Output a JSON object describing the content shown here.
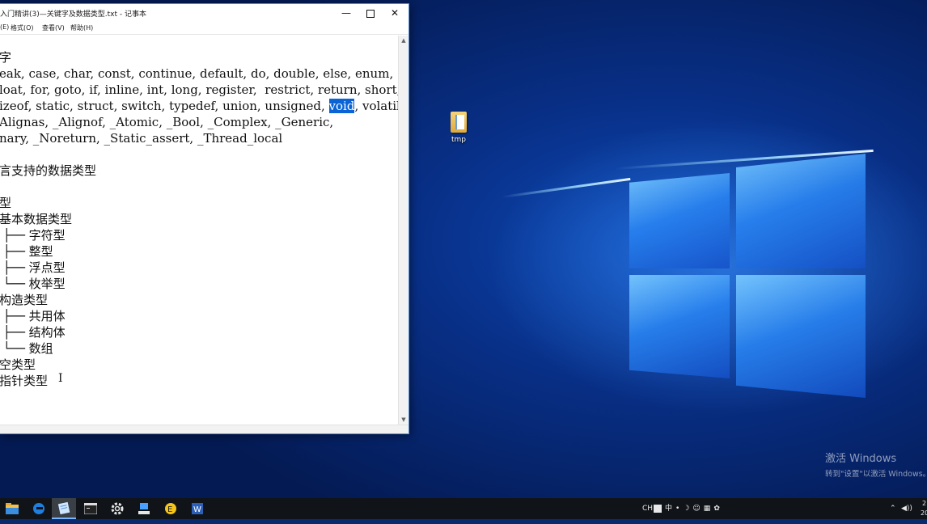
{
  "window": {
    "title": "入门精讲(3)—关键字及数据类型.txt - 记事本",
    "minimize_label": "—",
    "close_label": "✕"
  },
  "menu": {
    "items": [
      "(E)",
      "格式(O)",
      "查看(V)",
      "帮助(H)"
    ]
  },
  "editor": {
    "lines": [
      "字",
      "eak, case, char, const, continue, default, do, double, else, enum,",
      "loat, for, goto, if, inline, int, long, register,  restrict, return, short,",
      "izeof, static, struct, switch, typedef, union, unsigned, ",
      "Alignas, _Alignof, _Atomic, _Bool, _Complex, _Generic,",
      "nary, _Noreturn, _Static_assert, _Thread_local",
      "",
      "言支持的数据类型",
      "",
      "型",
      "基本数据类型",
      " ├── 字符型",
      " ├── 整型",
      " ├── 浮点型",
      " └── 枚举型",
      "构造类型",
      " ├── 共用体",
      " ├── 结构体",
      " └── 数组",
      "空类型",
      "指针类型"
    ],
    "selected_word": "void",
    "after_selection": ", volatile,",
    "cursor_glyph": "I"
  },
  "desktop": {
    "icon_label": "tmp"
  },
  "watermark": {
    "line1": "激活 Windows",
    "line2": "转到\"设置\"以激活 Windows。"
  },
  "tray": {
    "ime_text": "CH",
    "ime_mode": "中",
    "clock_fragment": "2",
    "clock_fragment2": "20"
  },
  "colors": {
    "selection": "#0a64d6",
    "taskbar": "#101418",
    "accent": "#7ab4ff"
  }
}
